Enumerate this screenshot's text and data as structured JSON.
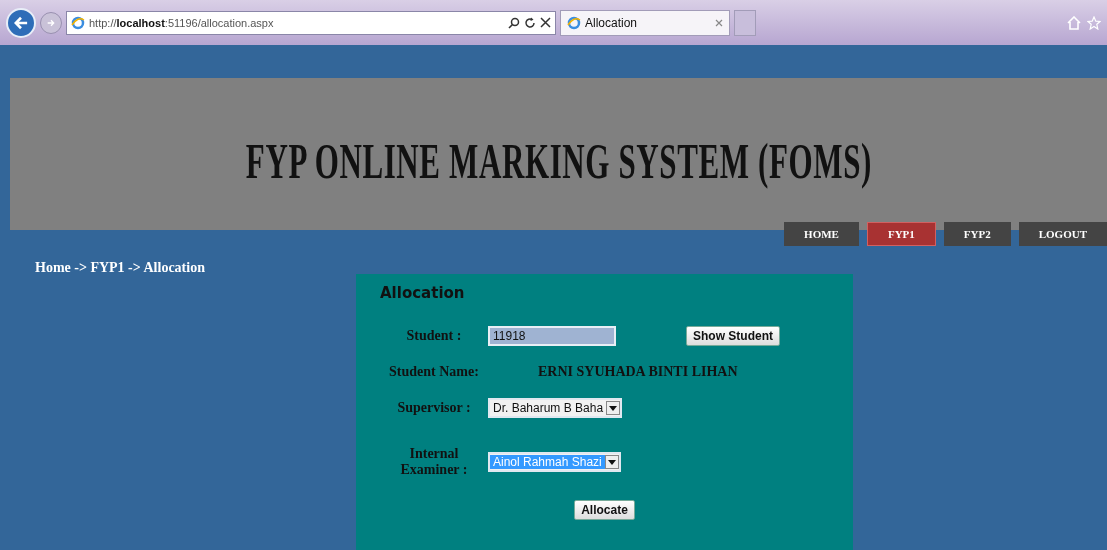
{
  "browser": {
    "address": "http://**localhost**:51196/allocation.aspx",
    "tab_title": "Allocation"
  },
  "banner": {
    "title": "FYP ONLINE MARKING SYSTEM (FOMS)"
  },
  "nav": [
    {
      "label": "HOME",
      "selected": false
    },
    {
      "label": "FYP1",
      "selected": true
    },
    {
      "label": "FYP2",
      "selected": false
    },
    {
      "label": "LOGOUT",
      "selected": false
    }
  ],
  "breadcrumb": "Home -> FYP1 -> Allocation",
  "form": {
    "title": "Allocation",
    "student_label": "Student :",
    "student_value": "11918",
    "show_button": "Show Student",
    "name_label": "Student Name:",
    "name_value": "ERNI SYUHADA BINTI LIHAN",
    "dropdowns": [
      {
        "label": "Supervisor :",
        "value": "Dr. Baharum B Baha",
        "focused": false
      },
      {
        "label": "Internal Examiner :",
        "value": "Ainol Rahmah Shazi",
        "focused": true
      }
    ],
    "submit": "Allocate"
  }
}
